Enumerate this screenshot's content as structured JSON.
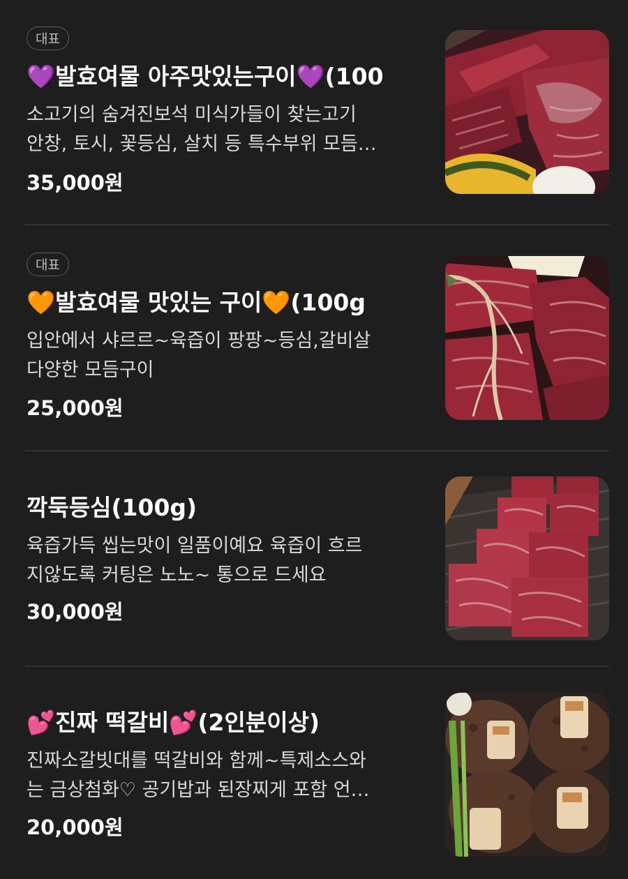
{
  "items": [
    {
      "badge": "대표",
      "title": "💜발효여물 아주맛있는구이💜(100",
      "desc": [
        "소고기의 숨겨진보석 미식가들이 찾는고기",
        "안창, 토시, 꽃등심, 살치 등 특수부위 모듬…"
      ],
      "price": "35,000원",
      "image": "raw-marbled-beef-slices-with-pumpkin"
    },
    {
      "badge": "대표",
      "title": "🧡발효여물 맛있는 구이🧡(100g",
      "desc": [
        "입안에서 샤르르~육즙이 팡팡~등심,갈비살",
        "다양한 모듬구이"
      ],
      "price": "25,000원",
      "image": "raw-beef-cuts-with-ginseng"
    },
    {
      "title": "깍둑등심(100g)",
      "desc": [
        "육즙가득 씹는맛이 일품이예요 육즙이 흐르",
        "지않도록 커팅은 노노~ 통으로 드세요"
      ],
      "price": "30,000원",
      "image": "cubed-raw-sirloin"
    },
    {
      "title": "💕진짜 떡갈비💕(2인분이상)",
      "desc": [
        "진짜소갈빗대를 떡갈비와 함께~특제소스와",
        "는 금상첨화♡ 공기밥과 된장찌게 포함 언…"
      ],
      "price": "20,000원",
      "image": "grilled-tteokgalbi-on-rib-bones"
    }
  ]
}
